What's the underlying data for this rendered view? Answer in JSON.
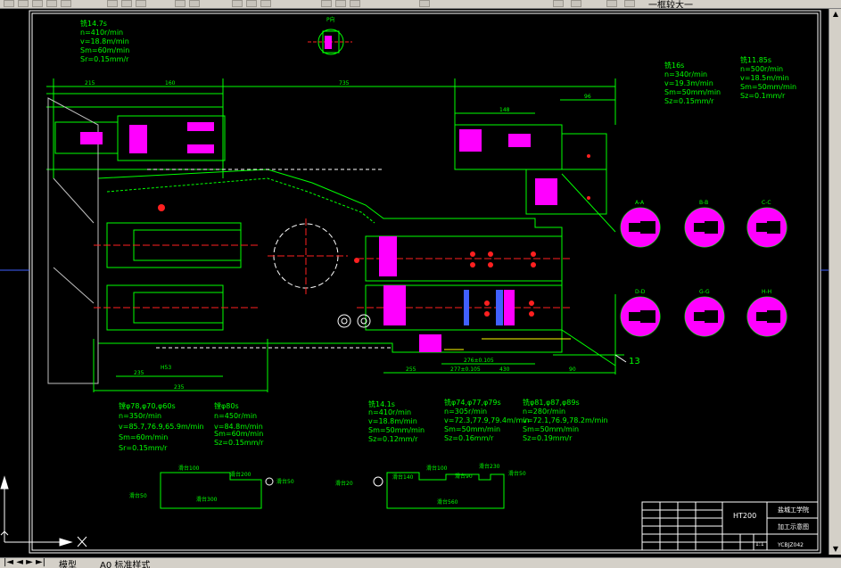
{
  "app": {
    "toolbar_label": "一框较大一",
    "tabs": [
      {
        "label": "模型"
      },
      {
        "label": "A0 标准样式"
      }
    ]
  },
  "drawing": {
    "section_top": {
      "label": "P向"
    },
    "notes_top_left": [
      "铣14.7s",
      "n=410r/min",
      "v=18.8m/min",
      "Sm=60m/min",
      "Sr=0.15mm/r"
    ],
    "notes_right_1": [
      "铣16s",
      "n=340r/min",
      "v=19.3m/min",
      "Sm=50mm/min",
      "Sz=0.15mm/r"
    ],
    "notes_right_2": [
      "铣11.85s",
      "n=500r/min",
      "v=18.5m/min",
      "Sm=50mm/min",
      "Sz=0.1mm/r"
    ],
    "notes_bottom_1": [
      "镗φ78,φ70,φ60s",
      "n=350r/min",
      "v=85.7,76.9,65.9m/min",
      "Sm=60m/min",
      "Sr=0.15mm/r"
    ],
    "notes_bottom_2": [
      "镗φ80s",
      "n=450r/min",
      "v=84.8m/min",
      "Sm=60m/min",
      "Sz=0.15mm/r"
    ],
    "notes_bottom_3": [
      "铣14.1s",
      "n=410r/min",
      "v=18.8m/min",
      "Sm=50mm/min",
      "Sz=0.12mm/r"
    ],
    "notes_bottom_4": [
      "铣φ74,φ77,φ79s",
      "n=305r/min",
      "v=72.3,77.9,79.4m/min",
      "Sm=50mm/min",
      "Sz=0.16mm/r"
    ],
    "notes_bottom_5": [
      "铣φ81,φ87,φ89s",
      "n=280r/min",
      "v=72.1,76.9,78.2m/min",
      "Sm=50mm/min",
      "Sz=0.19mm/r"
    ],
    "section_views": [
      {
        "label": "A-A"
      },
      {
        "label": "B-B"
      },
      {
        "label": "C-C"
      },
      {
        "label": "D-D"
      },
      {
        "label": "G-G"
      },
      {
        "label": "H-H"
      }
    ],
    "leader_label": "13",
    "fixture_1": {
      "top": "滑台100",
      "right": "滑台200",
      "side": "滑台50",
      "bottom": "滑台300",
      "end": "滑台50"
    },
    "fixture_2": {
      "left": "滑台20",
      "top1": "滑台140",
      "top2": "滑台100",
      "top3": "滑台230",
      "mid": "滑台90",
      "end": "滑台50",
      "bottom": "滑台560"
    },
    "dims_top": [
      "215",
      "160",
      "735",
      "148",
      "96"
    ],
    "dims_bottom": [
      "H53",
      "235",
      "235",
      "430",
      "276±0.105",
      "277±0.105",
      "255",
      "90"
    ],
    "title_block": {
      "material": "HT200",
      "school": "盐城工学院",
      "drawing_name": "加工示意图",
      "code": "YCBJZ042",
      "scale": "1:1"
    }
  },
  "colors": {
    "background": "#000000",
    "green": "#00ff00",
    "white": "#ffffff",
    "magenta": "#ff00ff",
    "red": "#ff2020",
    "yellow": "#ffff00",
    "cyan": "#00ffff",
    "blue": "#4060ff",
    "chrome": "#d4d0c8"
  }
}
